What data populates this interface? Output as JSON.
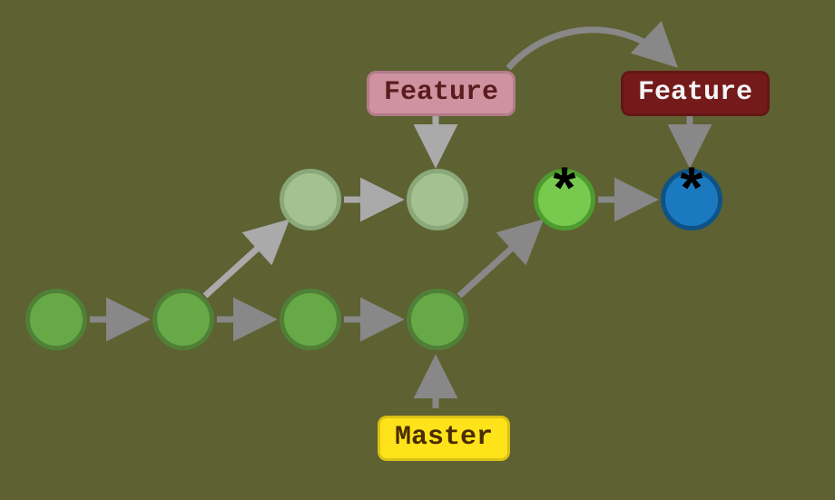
{
  "diagram": {
    "labels": {
      "featureOld": "Feature",
      "featureNew": "Feature",
      "master": "Master"
    },
    "nodes": {
      "m1": {
        "glyph": ""
      },
      "m2": {
        "glyph": ""
      },
      "m3": {
        "glyph": ""
      },
      "m4": {
        "glyph": ""
      },
      "f1_old": {
        "glyph": ""
      },
      "f2_old": {
        "glyph": ""
      },
      "r1": {
        "glyph": "*"
      },
      "r2": {
        "glyph": "*"
      }
    },
    "colors": {
      "bg": "#5e6131",
      "green": "#68a947",
      "greenBorder": "#507f37",
      "faded": "#a3c290",
      "bright": "#77ca4e",
      "blue": "#1b7abf",
      "arrow": "#888888",
      "arrowFaded": "#aaaaaa",
      "featureOld": "#cf92a0",
      "featureNew": "#751a1b",
      "master": "#ffe31a"
    }
  }
}
